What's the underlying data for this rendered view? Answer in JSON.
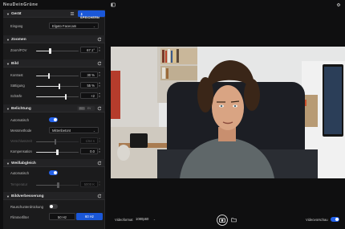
{
  "app": {
    "title": "NeuDeinGrüne"
  },
  "header": {
    "panel_toggle_icon": "sidebar-icon",
    "settings_icon": "gear-icon"
  },
  "camera": {
    "title": "Gerät",
    "input_label": "Eingang",
    "input_value": "Elgato Facecam",
    "save_label": "SPEICHERN"
  },
  "zoom": {
    "title": "Zoomen",
    "fov_label": "Zoom/FOV",
    "fov_value": "67.1°",
    "fov_fraction": 0.33
  },
  "image": {
    "title": "Bild",
    "contrast_label": "Kontrast",
    "contrast_value": "30 %",
    "contrast_fraction": 0.3,
    "saturation_label": "Sättigung",
    "saturation_value": "55 %",
    "saturation_fraction": 0.55,
    "sharpness_label": "Schärfe",
    "sharpness_value": "+2",
    "sharpness_fraction": 0.7
  },
  "exposure": {
    "title": "Belichtung",
    "segment_labels": [
      "ISO",
      "EV"
    ],
    "auto_label": "Automatisch",
    "auto_on": true,
    "metering_label": "Messmethode",
    "metering_value": "Mittenbetont",
    "shutter_label": "Verschlusszeit",
    "shutter_value": "1/64 s",
    "shutter_fraction": 0.45,
    "compensation_label": "Kompensation",
    "compensation_value": "0.0",
    "compensation_fraction": 0.5
  },
  "white_balance": {
    "title": "Weißabgleich",
    "auto_label": "Automatisch",
    "auto_on": true,
    "temperature_label": "Temperatur",
    "temperature_value": "5000 K",
    "temperature_fraction": 0.52
  },
  "image_enhance": {
    "title": "Bildverbesserung",
    "noise_label": "Rauschunterdrückung",
    "noise_on": false,
    "flicker_label": "Flimmerfilter",
    "flicker_options": [
      "50 Hz",
      "60 Hz"
    ],
    "flicker_selected": "60 Hz"
  },
  "footer": {
    "format_label": "Videoformat",
    "format_value": "1080p60",
    "preview_label": "Videovorschau",
    "preview_on": true
  },
  "colors": {
    "accent": "#1a57d8",
    "toggle_on": "#2563eb",
    "panel_bg": "#1b1b1c"
  }
}
